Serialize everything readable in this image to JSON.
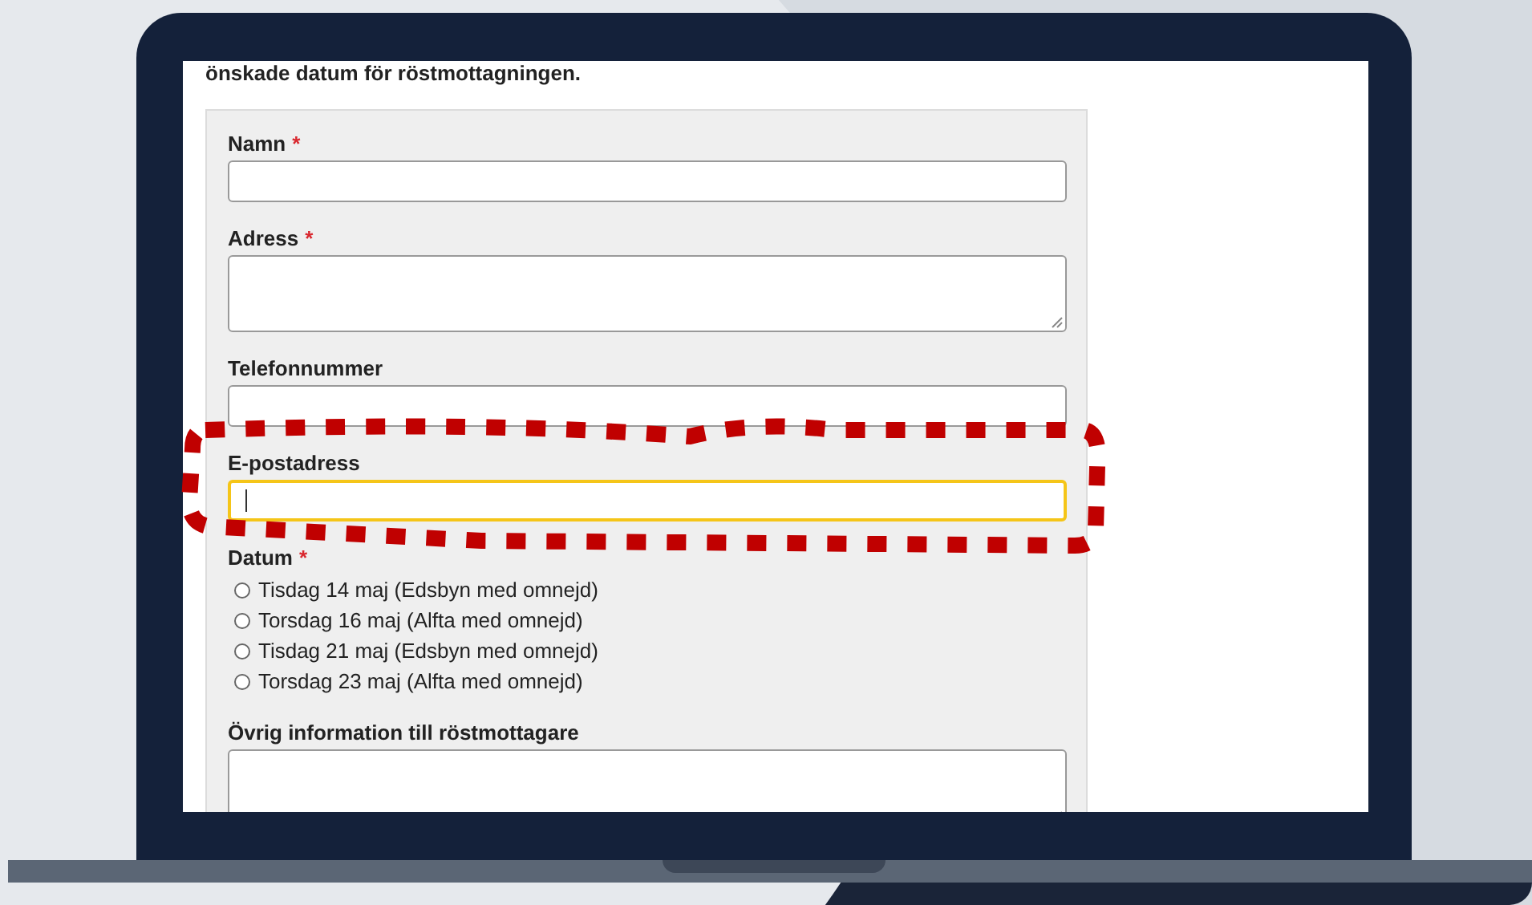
{
  "intro": "önskade datum för röstmottagningen.",
  "fields": [
    {
      "kind": "input",
      "label": "Namn",
      "required_mark": "*",
      "focused": false
    },
    {
      "kind": "textarea",
      "label": "Adress",
      "required_mark": "*",
      "focused": false
    },
    {
      "kind": "input",
      "label": "Telefonnummer",
      "focused": false
    },
    {
      "kind": "input",
      "label": "E-postadress",
      "focused": true
    },
    {
      "kind": "radio",
      "label": "Datum",
      "required_mark": "*",
      "options": [
        {
          "label": "Tisdag 14 maj (Edsbyn med omnejd)",
          "selected": false
        },
        {
          "label": "Torsdag 16 maj (Alfta med omnejd)",
          "selected": false
        },
        {
          "label": "Tisdag 21 maj (Edsbyn med omnejd)",
          "selected": false
        },
        {
          "label": "Torsdag 23 maj (Alfta med omnejd)",
          "selected": false
        }
      ]
    },
    {
      "kind": "textarea",
      "label": "Övrig information till röstmottagare",
      "focused": false
    }
  ]
}
